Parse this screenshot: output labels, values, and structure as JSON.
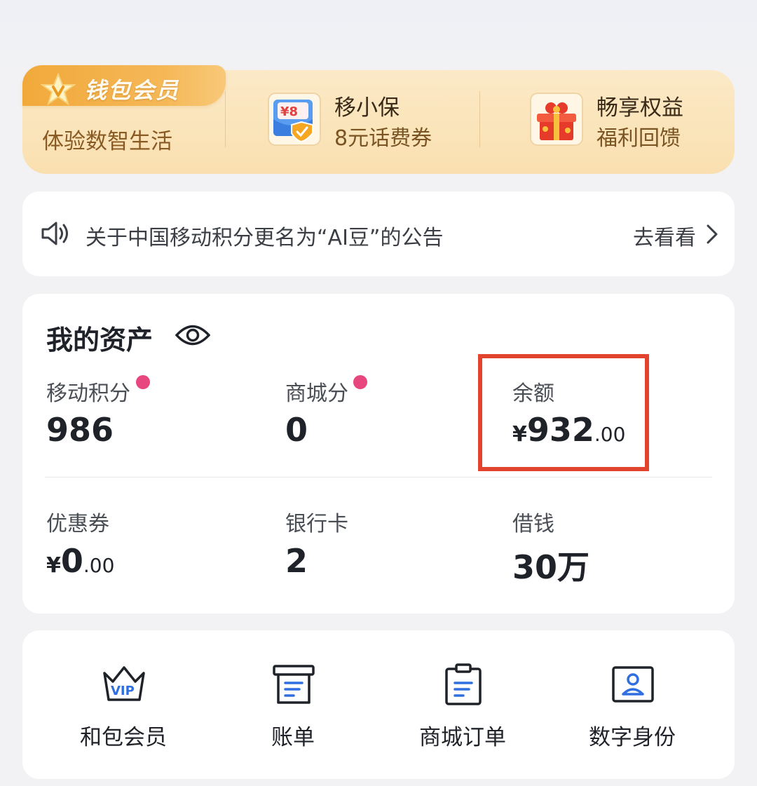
{
  "member_banner": {
    "tag_label": "钱包会员",
    "subtitle": "体验数智生活",
    "perks": [
      {
        "title": "移小保",
        "subtitle": "8元话费券",
        "icon": "coupon-shield-icon",
        "icon_text": "¥8"
      },
      {
        "title": "畅享权益",
        "subtitle": "福利回馈",
        "icon": "gift-box-icon"
      }
    ]
  },
  "notice": {
    "text": "关于中国移动积分更名为“AI豆”的公告",
    "link_label": "去看看"
  },
  "assets": {
    "title": "我的资产",
    "items": [
      {
        "label": "移动积分",
        "value": "986",
        "has_dot": true
      },
      {
        "label": "商城分",
        "value": "0",
        "has_dot": true
      },
      {
        "label": "余额",
        "currency": "¥",
        "integer": "932",
        "decimal": ".00",
        "highlighted": true
      },
      {
        "label": "优惠券",
        "currency": "¥",
        "integer": "0",
        "decimal": ".00"
      },
      {
        "label": "银行卡",
        "value": "2"
      },
      {
        "label": "借钱",
        "value": "30万"
      }
    ],
    "highlight_color": "#e2442f",
    "dot_color": "#e8467f"
  },
  "shortcuts": [
    {
      "label": "和包会员",
      "icon": "vip-crown-icon",
      "icon_text": "VIP"
    },
    {
      "label": "账单",
      "icon": "bill-icon"
    },
    {
      "label": "商城订单",
      "icon": "order-clipboard-icon"
    },
    {
      "label": "数字身份",
      "icon": "id-card-icon"
    }
  ],
  "colors": {
    "banner_bg": "#fae0b0",
    "tag_bg": "#f1a93a",
    "page_bg": "#f2f2f4",
    "icon_blue": "#2f6fe0"
  }
}
